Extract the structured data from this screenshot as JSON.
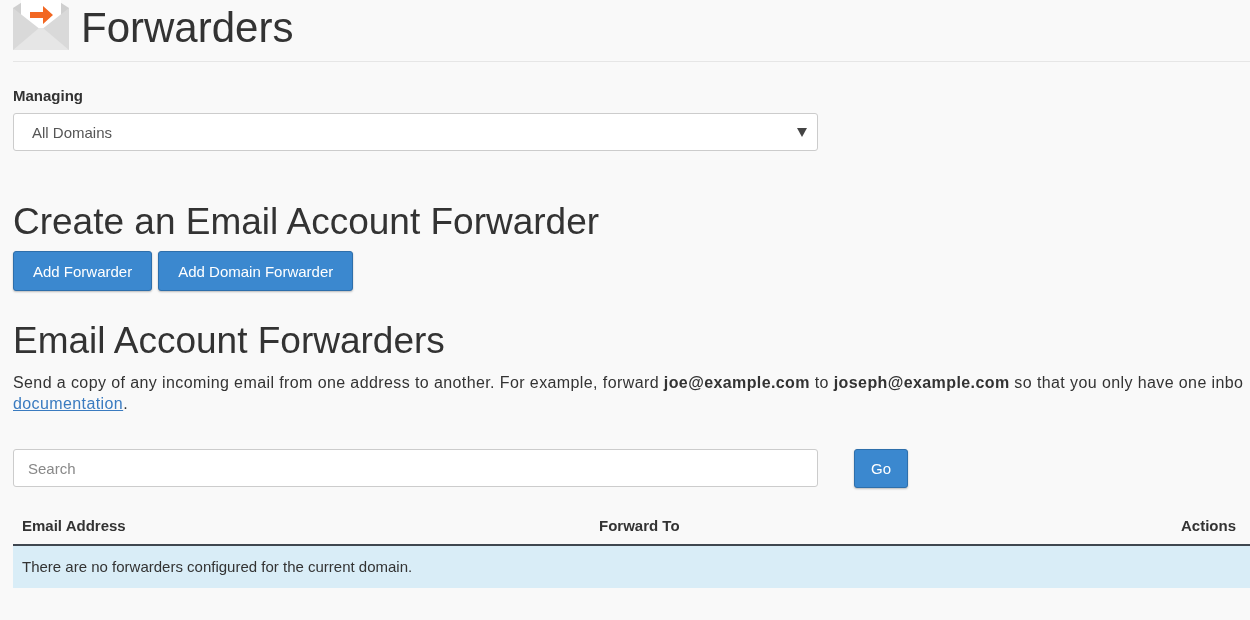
{
  "header": {
    "title": "Forwarders"
  },
  "managing": {
    "label": "Managing",
    "value": "All Domains"
  },
  "create_section": {
    "heading": "Create an Email Account Forwarder",
    "buttons": [
      "Add Forwarder",
      "Add Domain Forwarder"
    ]
  },
  "forwarders_section": {
    "heading": "Email Account Forwarders",
    "description": "Send a copy of any incoming email from one address to another. For example, forward **joe@example.com** to **joseph@example.com** so that you only have one inbo",
    "link": "documentation",
    "link_suffix": "."
  },
  "search": {
    "placeholder": "Search",
    "button": "Go"
  },
  "table": {
    "columns": [
      "Email Address",
      "Forward To",
      "Actions"
    ],
    "empty_message": "There are no forwarders configured for the current domain."
  }
}
